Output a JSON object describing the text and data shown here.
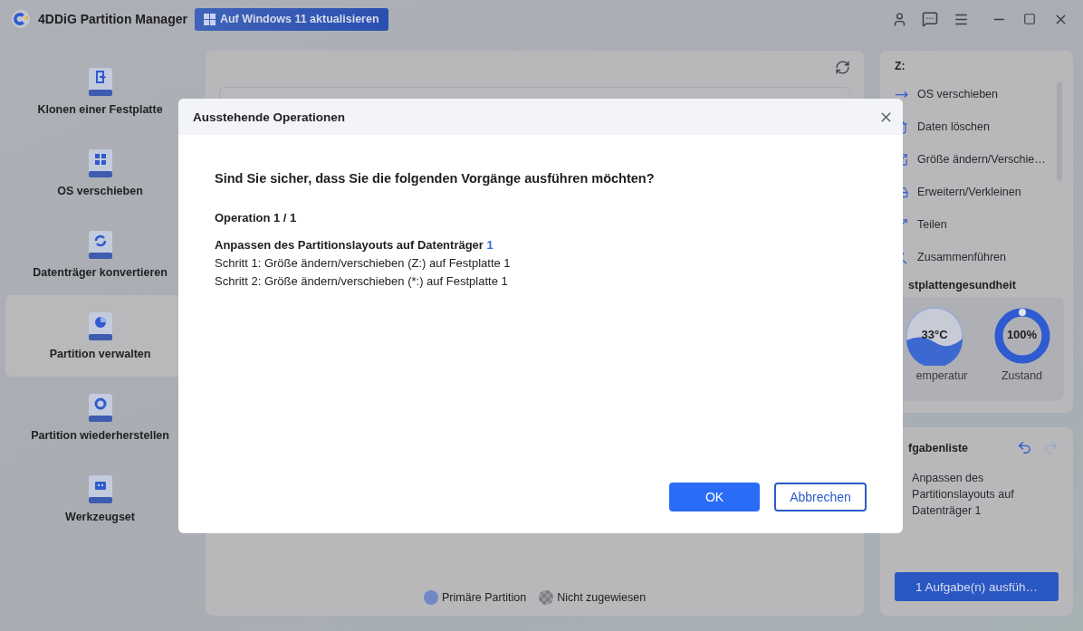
{
  "app": {
    "title": "4DDiG Partition Manager",
    "upgrade_button": "Auf Windows 11 aktualisieren"
  },
  "sidebar": {
    "items": [
      {
        "label": "Klonen einer Festplatte",
        "kind": "clone",
        "selected": false
      },
      {
        "label": "OS verschieben",
        "kind": "os",
        "selected": false
      },
      {
        "label": "Datenträger konvertieren",
        "kind": "convert",
        "selected": false
      },
      {
        "label": "Partition verwalten",
        "kind": "partition",
        "selected": true
      },
      {
        "label": "Partition wiederherstellen",
        "kind": "recover",
        "selected": false
      },
      {
        "label": "Werkzeugset",
        "kind": "toolbox",
        "selected": false
      }
    ]
  },
  "legend": [
    {
      "label": "Primäre Partition",
      "kind": "primary"
    },
    {
      "label": "Nicht zugewiesen",
      "kind": "unallocated"
    }
  ],
  "right_panel": {
    "drive": "Z:",
    "actions": [
      "OS verschieben",
      "Daten löschen",
      "Größe ändern/Verschie…",
      "Erweitern/Verkleinen",
      "Teilen",
      "Zusammenführen"
    ],
    "health_title": "stplattengesundheit",
    "temperature": {
      "value": "33°C",
      "label": "emperatur"
    },
    "condition": {
      "value": "100%",
      "label": "Zustand",
      "level": 1
    },
    "task_title": "fgabenliste",
    "tasks": [
      "Anpassen des Partitionslayouts auf Datenträger 1"
    ],
    "run_button": "1 Aufgabe(n) ausfüh…"
  },
  "dialog": {
    "title": "Ausstehende Operationen",
    "question": "Sind Sie sicher, dass Sie die folgenden Vorgänge ausführen möchten?",
    "operation": "Operation 1 / 1",
    "heading": "Anpassen des Partitionslayouts auf Datenträger",
    "disk_number": "1",
    "steps": [
      "Schritt 1: Größe ändern/verschieben (Z:) auf Festplatte 1",
      "Schritt 2: Größe ändern/verschieben (*:) auf Festplatte 1"
    ],
    "buttons": [
      {
        "label": "OK",
        "kind": "primary"
      },
      {
        "label": "Abbrechen",
        "kind": "secondary"
      }
    ]
  }
}
